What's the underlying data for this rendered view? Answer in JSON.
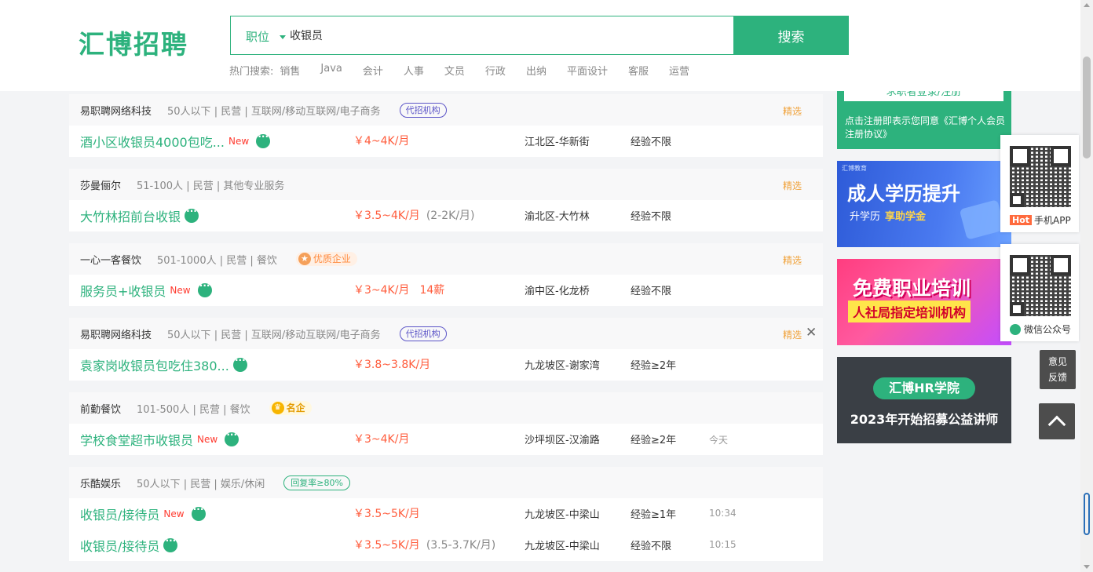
{
  "header": {
    "logo": "汇博招聘",
    "search_type": "职位",
    "search_value": "收银员",
    "search_button": "搜索",
    "hot_label": "热门搜索:",
    "hot_items": [
      "销售",
      "Java",
      "会计",
      "人事",
      "文员",
      "行政",
      "出纳",
      "平面设计",
      "客服",
      "运营"
    ]
  },
  "companies": [
    {
      "name": "易职聘网络科技",
      "info": "50人以下 | 民营 | 互联网/移动互联网/电子商务",
      "tag": "代招机构",
      "pick": "精选",
      "jobs": [
        {
          "title": "酒小区收银员4000包吃...",
          "new": "New",
          "salary": "￥4~4K/月",
          "salary_extra": "",
          "location": "江北区-华新街",
          "experience": "经验不限",
          "time": ""
        }
      ]
    },
    {
      "name": "莎曼俪尔",
      "info": "51-100人 | 民营 | 其他专业服务",
      "tag": "",
      "pick": "精选",
      "jobs": [
        {
          "title": "大竹林招前台收银",
          "new": "",
          "salary": "￥3.5~4K/月",
          "salary_extra": "(2-2K/月)",
          "location": "渝北区-大竹林",
          "experience": "经验不限",
          "time": ""
        }
      ]
    },
    {
      "name": "一心一客餐饮",
      "info": "501-1000人 | 民营 | 餐饮",
      "tag": "优质企业",
      "pick": "精选",
      "jobs": [
        {
          "title": "服务员+收银员",
          "new": "New",
          "salary": "￥3~4K/月",
          "salary_extra": "14薪",
          "location": "渝中区-化龙桥",
          "experience": "经验不限",
          "time": ""
        }
      ]
    },
    {
      "name": "易职聘网络科技",
      "info": "50人以下 | 民营 | 互联网/移动互联网/电子商务",
      "tag": "代招机构",
      "pick": "精选",
      "close": "✕",
      "jobs": [
        {
          "title": "袁家岗收银员包吃住380...",
          "new": "",
          "salary": "￥3.8~3.8K/月",
          "salary_extra": "",
          "location": "九龙坡区-谢家湾",
          "experience": "经验≥2年",
          "time": ""
        }
      ]
    },
    {
      "name": "前勤餐饮",
      "info": "101-500人 | 民营 | 餐饮",
      "tag": "名企",
      "pick": "",
      "jobs": [
        {
          "title": "学校食堂超市收银员",
          "new": "New",
          "salary": "￥3~4K/月",
          "salary_extra": "",
          "location": "沙坪坝区-汉渝路",
          "experience": "经验≥2年",
          "time": "今天"
        }
      ]
    },
    {
      "name": "乐酷娱乐",
      "info": "50人以下 | 民营 | 娱乐/休闲",
      "tag": "回复率≥80%",
      "pick": "",
      "jobs": [
        {
          "title": "收银员/接待员",
          "new": "New",
          "salary": "￥3.5~5K/月",
          "salary_extra": "",
          "location": "九龙坡区-中梁山",
          "experience": "经验≥1年",
          "time": "10:34"
        },
        {
          "title": "收银员/接待员",
          "new": "",
          "salary": "￥3.5~5K/月",
          "salary_extra": "(3.5-3.7K/月)",
          "location": "九龙坡区-中梁山",
          "experience": "经验不限",
          "time": "10:15"
        }
      ]
    }
  ],
  "sidebar": {
    "register_button": "求职者登录/注册",
    "register_terms": "点击注册即表示您同意《汇博个人会员注册协议》",
    "banner1": {
      "brand": "汇博教育",
      "title": "成人学历提升",
      "sub": "升学历",
      "sub_highlight": "享助学金"
    },
    "banner2": {
      "title": "免费职业培训",
      "sub": "人社局指定培训机构"
    },
    "banner3": {
      "title": "汇博HR学院",
      "sub": "2023年开始招募公益讲师"
    }
  },
  "float": {
    "app_hot": "Hot",
    "app_label": "手机APP",
    "wechat_label": "微信公众号",
    "feedback_line1": "意见",
    "feedback_line2": "反馈"
  },
  "icons": {
    "chat": "chat-bubble-icon",
    "back_to_top": "chevron-up-icon",
    "close": "close-icon",
    "wechat": "wechat-icon"
  },
  "colors": {
    "brand_green": "#2db27d",
    "salary_red": "#ff5b3b",
    "pick_orange": "#f0a23a",
    "new_red": "#ff3b30"
  }
}
